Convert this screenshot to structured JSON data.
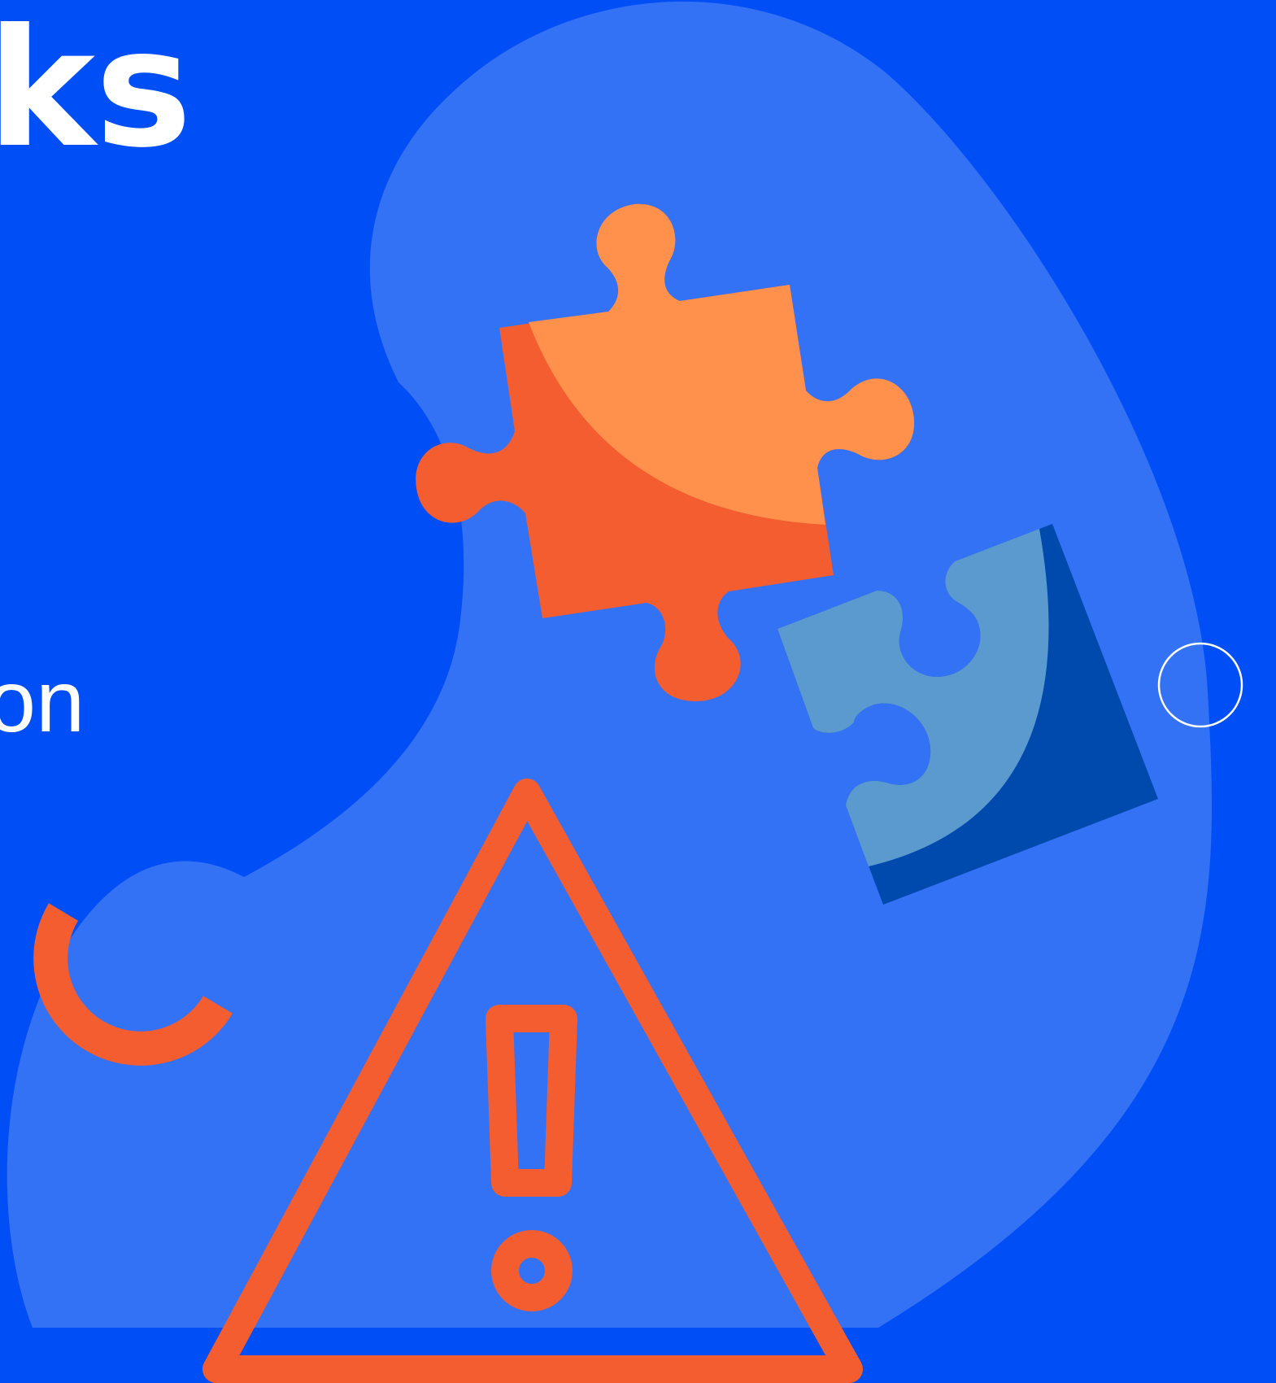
{
  "headline": {
    "text": "ks"
  },
  "subline": {
    "text": "on"
  },
  "colors": {
    "background": "#004EF5",
    "blob": "#3371F5",
    "orange": "#F45D30",
    "orange_light": "#FF914D",
    "blue_light": "#5B9ACF",
    "blue_dark": "#004AAD",
    "white": "#FFFFFF"
  },
  "icons": [
    "puzzle-piece-orange-icon",
    "puzzle-piece-blue-icon",
    "warning-triangle-icon",
    "exclamation-icon",
    "ring-outline-icon",
    "arc-icon"
  ]
}
